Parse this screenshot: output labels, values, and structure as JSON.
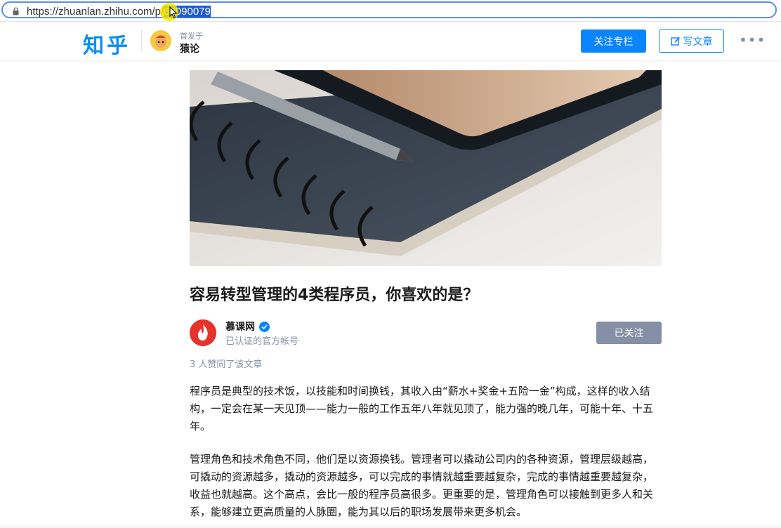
{
  "browser": {
    "url_prefix": "https://zhuanlan.zhihu.com/p/",
    "url_highlight_a": "6",
    "url_highlight_b": "0090079"
  },
  "header": {
    "logo": "知乎",
    "first_published_label": "首发于",
    "column_name": "猿论",
    "follow_column_label": "关注专栏",
    "write_article_label": "写文章",
    "more_label": "•••"
  },
  "article": {
    "title": "容易转型管理的4类程序员，你喜欢的是？",
    "author_name": "慕课网",
    "author_desc": "已认证的官方帐号",
    "followed_label": "已关注",
    "upvote_text": "3 人赞同了该文章",
    "paragraphs": [
      "程序员是典型的技术饭，以技能和时间换钱，其收入由“薪水+奖金+五险一金”构成，这样的收入结构，一定会在某一天见顶——能力一般的工作五年八年就见顶了，能力强的晚几年，可能十年、十五年。",
      "管理角色和技术角色不同，他们是以资源换钱。管理者可以撬动公司内的各种资源，管理层级越高，可撬动的资源越多，撬动的资源越多，可以完成的事情就越重要越复杂，完成的事情越重要越复杂，收益也就越高。这个高点，会比一般的程序员高很多。更重要的是，管理角色可以接触到更多人和关系，能够建立更高质量的人脉圈，能为其以后的职场发展带来更多机会。"
    ]
  },
  "colors": {
    "brand": "#0a8ff7",
    "primary_button": "#0a84ff",
    "followed_button": "#8590a6",
    "author_avatar": "#e8322b"
  }
}
